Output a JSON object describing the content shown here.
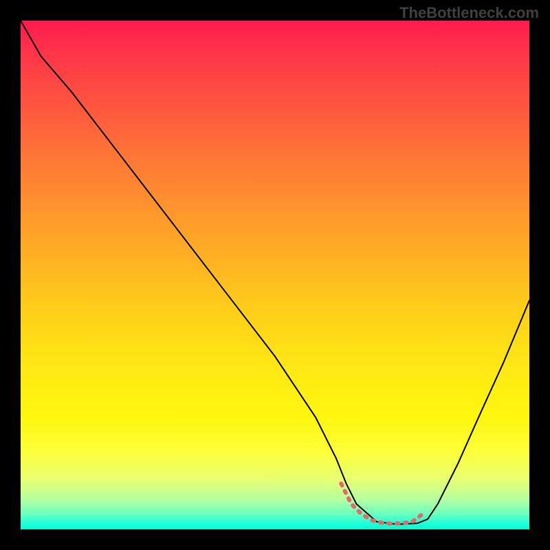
{
  "watermark": "TheBottleneck.com",
  "chart_data": {
    "type": "line",
    "title": "",
    "xlabel": "",
    "ylabel": "",
    "xlim": [
      0,
      100
    ],
    "ylim": [
      0,
      100
    ],
    "series": [
      {
        "name": "curve",
        "color": "#000000",
        "x": [
          0,
          4,
          10,
          20,
          30,
          40,
          50,
          58,
          62,
          64,
          66,
          70,
          74,
          78,
          80,
          82,
          86,
          90,
          95,
          100
        ],
        "y": [
          100,
          93,
          86,
          73,
          60,
          47,
          34,
          22,
          14,
          9,
          5,
          1.5,
          1,
          1.2,
          2,
          5,
          13,
          22,
          33,
          45
        ]
      },
      {
        "name": "highlight",
        "color": "#e26a6a",
        "x": [
          63,
          65,
          67,
          69,
          71,
          73,
          75,
          77,
          79
        ],
        "y": [
          9,
          5,
          3,
          1.8,
          1.3,
          1.1,
          1.2,
          1.5,
          3
        ]
      }
    ],
    "gradient_stops": [
      {
        "pct": 0,
        "color": "#ff1a4d"
      },
      {
        "pct": 15,
        "color": "#ff5040"
      },
      {
        "pct": 42,
        "color": "#ffa328"
      },
      {
        "pct": 68,
        "color": "#ffe814"
      },
      {
        "pct": 90,
        "color": "#e8ff70"
      },
      {
        "pct": 100,
        "color": "#00ffd0"
      }
    ]
  }
}
